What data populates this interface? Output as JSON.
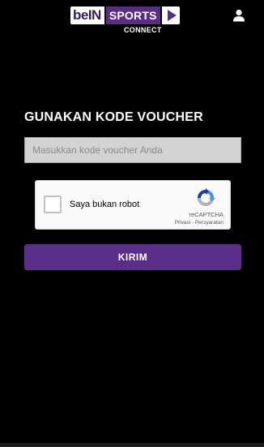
{
  "header": {
    "logo": {
      "bein": "beIN",
      "sports": "SPORTS",
      "connect": "CONNECT"
    },
    "user_icon": "user-icon"
  },
  "main": {
    "title": "GUNAKAN KODE VOUCHER",
    "voucher_input": {
      "value": "",
      "placeholder": "Masukkan kode voucher Anda"
    },
    "recaptcha": {
      "label": "Saya bukan robot",
      "brand": "reCAPTCHA",
      "privacy": "Privasi",
      "separator": " - ",
      "terms": "Persyaratan"
    },
    "submit_label": "KIRIM"
  },
  "colors": {
    "background": "#000000",
    "accent": "#5a2d8a",
    "input_background": "#d3d3d3"
  }
}
